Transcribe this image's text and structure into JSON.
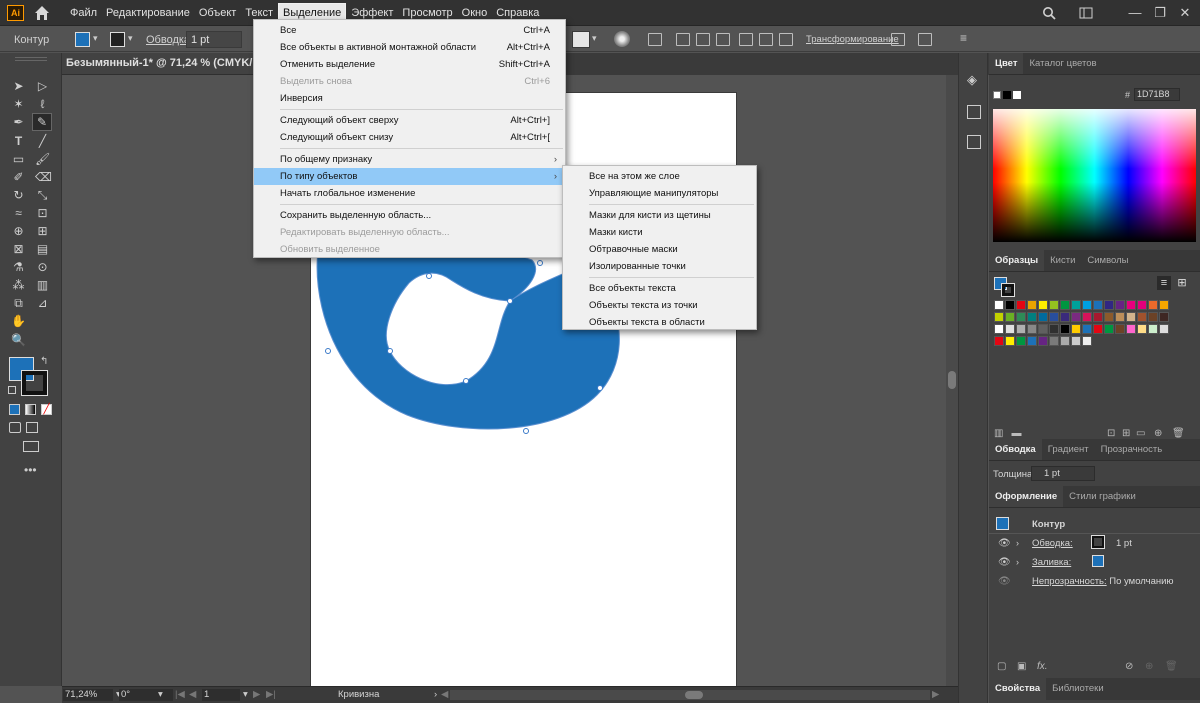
{
  "app": {
    "logo": "Ai"
  },
  "menubar": {
    "items": [
      "Файл",
      "Редактирование",
      "Объект",
      "Текст",
      "Выделение",
      "Эффект",
      "Просмотр",
      "Окно",
      "Справка"
    ],
    "active_index": 4
  },
  "controlbar": {
    "object_type": "Контур",
    "stroke_label": "Обводка:",
    "stroke_value": "1 pt",
    "transform_link": "Трансформирование"
  },
  "document": {
    "tab_title": "Безымянный-1* @ 71,24 % (CMYK/Предпросмотр)"
  },
  "selection_menu": {
    "items": [
      {
        "label": "Все",
        "shortcut": "Ctrl+A",
        "disabled": false
      },
      {
        "label": "Все объекты в активной монтажной области",
        "shortcut": "Alt+Ctrl+A",
        "disabled": false
      },
      {
        "label": "Отменить выделение",
        "shortcut": "Shift+Ctrl+A",
        "disabled": false
      },
      {
        "label": "Выделить снова",
        "shortcut": "Ctrl+6",
        "disabled": true
      },
      {
        "label": "Инверсия",
        "shortcut": "",
        "disabled": false
      },
      {
        "label": "Следующий объект сверху",
        "shortcut": "Alt+Ctrl+]",
        "disabled": false
      },
      {
        "label": "Следующий объект снизу",
        "shortcut": "Alt+Ctrl+[",
        "disabled": false
      },
      {
        "label": "По общему признаку",
        "shortcut": "",
        "disabled": false
      },
      {
        "label": "По типу объектов",
        "shortcut": "",
        "disabled": false
      },
      {
        "label": "Начать глобальное изменение",
        "shortcut": "",
        "disabled": false
      },
      {
        "label": "Сохранить выделенную область...",
        "shortcut": "",
        "disabled": false
      },
      {
        "label": "Редактировать выделенную область...",
        "shortcut": "",
        "disabled": true
      },
      {
        "label": "Обновить выделенное",
        "shortcut": "",
        "disabled": true
      }
    ]
  },
  "object_type_submenu": {
    "items": [
      "Все на этом же слое",
      "Управляющие манипуляторы",
      "Мазки для кисти из щетины",
      "Мазки кисти",
      "Обтравочные маски",
      "Изолированные точки",
      "Все объекты текста",
      "Объекты текста из точки",
      "Объекты текста в области"
    ]
  },
  "color_panel": {
    "tabs": [
      "Цвет",
      "Каталог цветов"
    ],
    "hex_prefix": "#",
    "hex_value": "1D71B8"
  },
  "swatches_panel": {
    "tabs": [
      "Образцы",
      "Кисти",
      "Символы"
    ],
    "colors_row1": [
      "#ffffff",
      "#000000",
      "#e30613",
      "#e9a400",
      "#ffed00",
      "#95c11f",
      "#009640",
      "#00a19a",
      "#009fe3",
      "#1d71b8",
      "#312783",
      "#662483",
      "#e6007e",
      "#e4007c",
      "#eb6a2b",
      "#f7a600"
    ],
    "colors_row2": [
      "#c2d100",
      "#6ab023",
      "#2e8b57",
      "#00807f",
      "#006b9e",
      "#284e9e",
      "#3a2a7c",
      "#7a2a80",
      "#d4145a",
      "#a6192e",
      "#8b5a2b",
      "#bc8f5a",
      "#d2b48c",
      "#a0522d",
      "#6b4226",
      "#3e2723"
    ],
    "colors_row3": [
      "#ffffff",
      "#e0e0e0",
      "#b0b0b0",
      "#888888",
      "#606060",
      "#303030",
      "#000000",
      "#ffcc00",
      "#1d71b8",
      "#e30613",
      "#009640",
      "#6b4226",
      "#ff66cc",
      "#ffdd88",
      "#cceecc",
      "#dddddd"
    ],
    "colors_row4": [
      "#e30613",
      "#ffed00",
      "#009640",
      "#1d71b8",
      "#662483",
      "#7a7a7a",
      "#aaaaaa",
      "#cccccc",
      "#eeeeee"
    ]
  },
  "stroke_panel": {
    "tabs": [
      "Обводка",
      "Градиент",
      "Прозрачность"
    ],
    "weight_label": "Толщина:",
    "weight_value": "1 pt"
  },
  "appearance_panel": {
    "tabs": [
      "Оформление",
      "Стили графики"
    ],
    "object_label": "Контур",
    "stroke_label": "Обводка:",
    "stroke_value": "1 pt",
    "fill_label": "Заливка:",
    "opacity_label": "Непрозрачность:",
    "opacity_value": "По умолчанию"
  },
  "bottom_tabs": [
    "Свойства",
    "Библиотеки"
  ],
  "statusbar": {
    "zoom": "71,24%",
    "rotation": "0°",
    "artboard_number": "1",
    "tool_name": "Кривизна"
  },
  "colors": {
    "fill": "#1d71b8",
    "menu_highlight": "#91c9f7",
    "menubar_bg": "#323232",
    "panel_bg": "#424242"
  }
}
